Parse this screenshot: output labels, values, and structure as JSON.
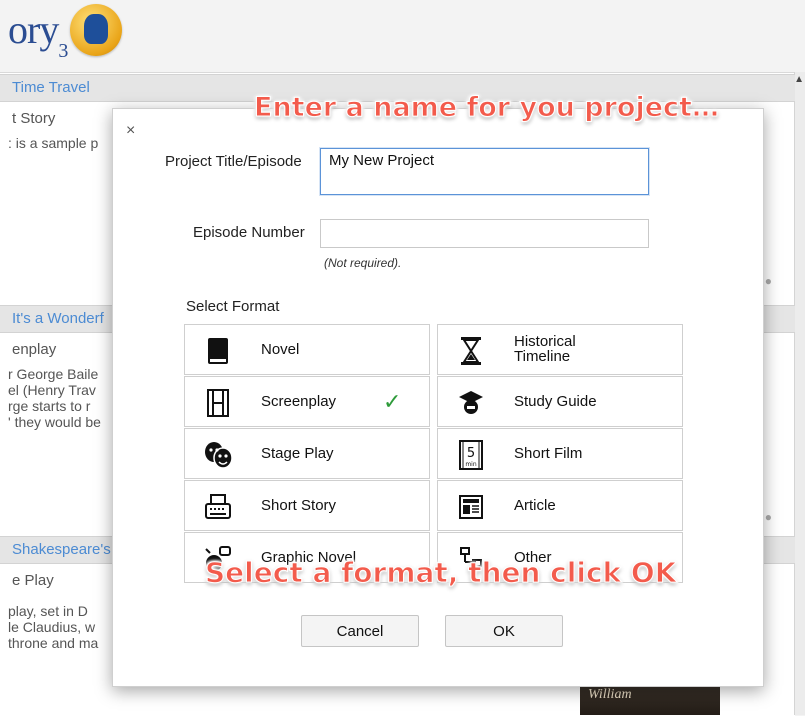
{
  "app": {
    "logo_text": "ory",
    "logo_sub": "3"
  },
  "projects": [
    {
      "title": "Time Travel",
      "type": "t Story",
      "desc": ": is a sample p"
    },
    {
      "title": "It's a Wonderf",
      "type": "enplay",
      "desc": [
        "r George Baile",
        "el (Henry Trav",
        "rge starts to r",
        "' they would be"
      ]
    },
    {
      "title": "Shakespeare's",
      "type": "e Play",
      "desc": [
        "play, set in D",
        "le Claudius, w",
        "throne and ma"
      ]
    }
  ],
  "book_thumb_text": "William",
  "dialog": {
    "close_label": "×",
    "project_title_label": "Project Title/Episode",
    "project_title_value": "My New Project",
    "episode_number_label": "Episode Number",
    "episode_number_value": "",
    "episode_hint": "(Not required).",
    "select_format_label": "Select Format",
    "formats": [
      {
        "label": "Novel",
        "icon": "book-icon"
      },
      {
        "label": "Historical Timeline",
        "icon": "hourglass-icon"
      },
      {
        "label": "Screenplay",
        "icon": "film-icon",
        "selected": true
      },
      {
        "label": "Study Guide",
        "icon": "graduation-cap-icon"
      },
      {
        "label": "Stage Play",
        "icon": "theater-masks-icon"
      },
      {
        "label": "Short Film",
        "icon": "five-min-icon"
      },
      {
        "label": "Short Story",
        "icon": "typewriter-icon"
      },
      {
        "label": "Article",
        "icon": "newspaper-icon"
      },
      {
        "label": "Graphic Novel",
        "icon": "comic-icon"
      },
      {
        "label": "Other",
        "icon": "flowchart-icon"
      }
    ],
    "check_mark": "✓",
    "cancel_label": "Cancel",
    "ok_label": "OK"
  },
  "callouts": {
    "top": "Enter a name for you project…",
    "bottom": "Select a format, then click OK"
  },
  "colors": {
    "accent": "#4c8bd3",
    "callout": "#f35b4c",
    "check": "#2e9b3a"
  }
}
